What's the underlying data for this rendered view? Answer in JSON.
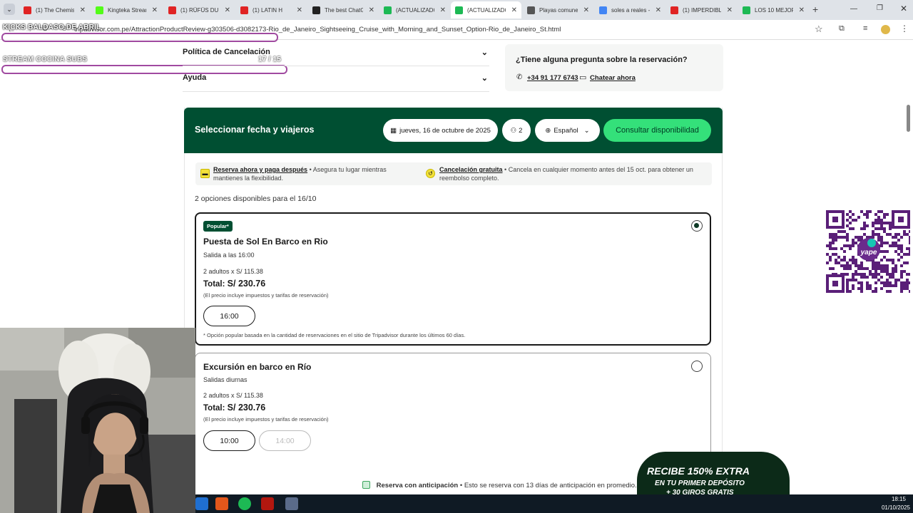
{
  "browser": {
    "tabs": [
      {
        "label": "(1) The Chemis",
        "color": "#e02424"
      },
      {
        "label": "Kingteka Stream",
        "color": "#53fc18"
      },
      {
        "label": "(1) RÜFÜS DU",
        "color": "#e02424"
      },
      {
        "label": "(1) LATIN H",
        "color": "#e02424"
      },
      {
        "label": "The best ChatG",
        "color": "#222222"
      },
      {
        "label": "(ACTUALIZADO",
        "color": "#1db954"
      },
      {
        "label": "(ACTUALIZADO",
        "color": "#1db954"
      },
      {
        "label": "Playas comunes",
        "color": "#555555"
      },
      {
        "label": "soles a reales -",
        "color": "#4285f4"
      },
      {
        "label": "(1) IMPERDIBL",
        "color": "#e02424"
      },
      {
        "label": "LOS 10 MEJOR",
        "color": "#1db954"
      }
    ],
    "new_tab": "+",
    "url": "tripadvisor.com.pe/AttractionProductReview-g303506-d3082173-Rio_de_Janeiro_Sightseeing_Cruise_with_Morning_and_Sunset_Option-Rio_de_Janeiro_St.html"
  },
  "overlay": {
    "kicks_label": "KICKS BALDASO DE ABRIL",
    "stream_label": "STREAM COCINA SUBS",
    "counter": "17 / 15"
  },
  "accordion": {
    "cancel": "Política de Cancelación",
    "help": "Ayuda"
  },
  "question": {
    "title": "¿Tiene alguna pregunta sobre la reservación?",
    "phone": "+34 91 177 6743",
    "chat": "Chatear ahora"
  },
  "booking": {
    "title": "Seleccionar fecha y viajeros",
    "date": "jueves, 16 de octubre de 2025",
    "travelers": "2",
    "language": "Español",
    "check_btn": "Consultar disponibilidad",
    "reserve_link": "Reserva ahora y paga después",
    "reserve_text": "• Asegura tu lugar mientras mantienes la flexibilidad.",
    "cancel_link": "Cancelación gratuita",
    "cancel_text": "• Cancela en cualquier momento antes del 15 oct. para obtener un reembolso completo.",
    "options_count": "2 opciones disponibles para el 16/10"
  },
  "options": [
    {
      "badge": "Popular*",
      "title": "Puesta de Sol En Barco en Rio",
      "departure": "Salida a las 16:00",
      "price_line": "2 adultos x S/ 115.38",
      "total_label": "Total:",
      "total": "S/ 230.76",
      "tax_note": "(El precio incluye impuestos y tarifas de reservación)",
      "times": [
        "16:00"
      ],
      "footnote": "* Opción popular basada en la cantidad de reservaciones en el sitio de Tripadvisor durante los últimos 60 días."
    },
    {
      "title": "Excursión en barco en Río",
      "departure": "Salidas diurnas",
      "price_line": "2 adultos x S/ 115.38",
      "total_label": "Total:",
      "total": "S/ 230.76",
      "tax_note": "(El precio incluye impuestos y tarifas de reservación)",
      "times": [
        "10:00",
        "14:00"
      ]
    }
  ],
  "advance": {
    "bold": "Reserva con anticipación",
    "text": "• Esto se reserva con 13 días de anticipación en promedio."
  },
  "promo": {
    "line1": "RECIBE 150% EXTRA",
    "line2": "EN TU PRIMER DEPÓSITO",
    "line3": "+ 30 GIROS GRATIS"
  },
  "qr_label": "yape",
  "taskbar": {
    "time": "18:15",
    "date": "01/10/2025"
  }
}
